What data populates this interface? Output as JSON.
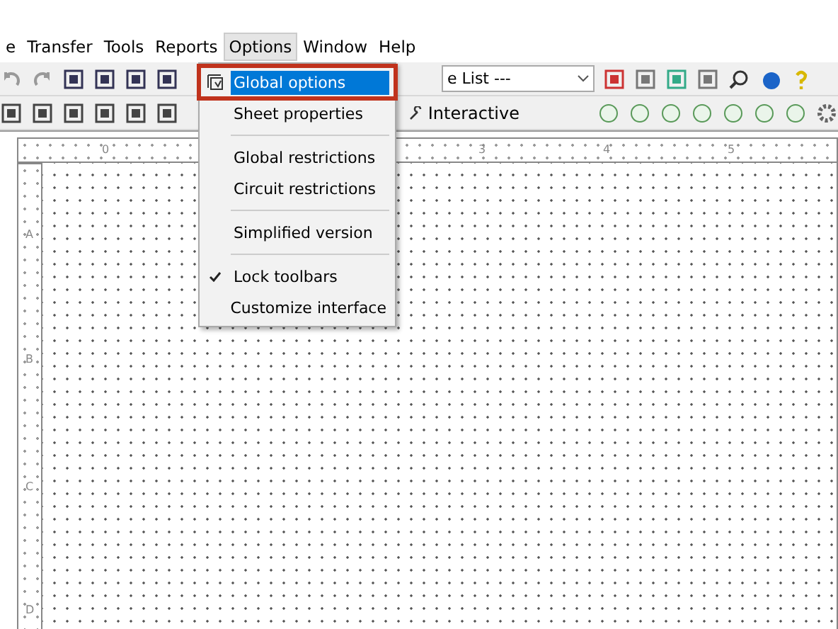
{
  "menu_bar": [
    {
      "label": "e",
      "selected": false
    },
    {
      "label": "Transfer",
      "selected": false
    },
    {
      "label": "Tools",
      "selected": false
    },
    {
      "label": "Reports",
      "selected": false
    },
    {
      "label": "Options",
      "selected": true
    },
    {
      "label": "Window",
      "selected": false
    },
    {
      "label": "Help",
      "selected": false
    }
  ],
  "toolbar": {
    "list_combo": {
      "value": "e List ---"
    },
    "interactive_button": {
      "label": "Interactive"
    }
  },
  "options_menu": {
    "groups": [
      [
        {
          "label": "Global options",
          "selected": true,
          "checked": false,
          "icon": true
        },
        {
          "label": "Sheet properties",
          "selected": false,
          "checked": false,
          "icon": false
        }
      ],
      [
        {
          "label": "Global restrictions",
          "selected": false,
          "checked": false,
          "icon": false
        },
        {
          "label": "Circuit restrictions",
          "selected": false,
          "checked": false,
          "icon": false
        }
      ],
      [
        {
          "label": "Simplified version",
          "selected": false,
          "checked": false,
          "icon": false
        }
      ],
      [
        {
          "label": "Lock toolbars",
          "selected": false,
          "checked": true,
          "icon": false
        },
        {
          "label": "Customize interface",
          "selected": false,
          "checked": false,
          "icon": false
        }
      ]
    ]
  },
  "sheet": {
    "column_labels": [
      "0",
      "3",
      "4",
      "5"
    ],
    "row_labels": [
      "A",
      "B",
      "C",
      "D"
    ]
  }
}
